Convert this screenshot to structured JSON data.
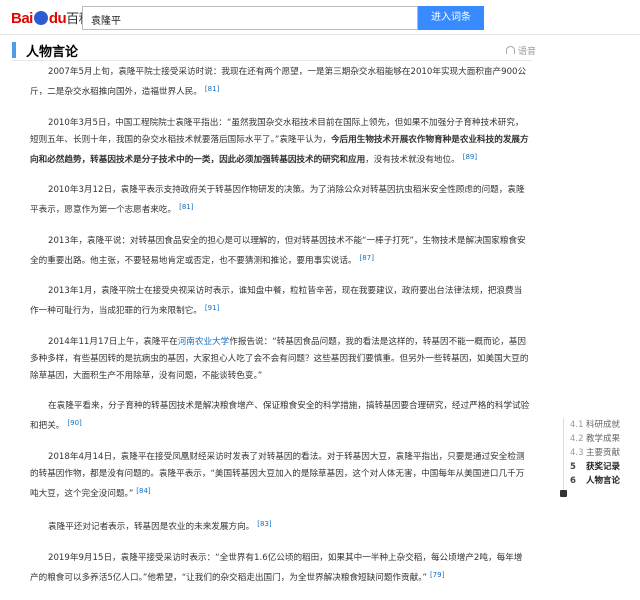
{
  "header": {
    "logo_text": "Bai",
    "logo_text2": "du",
    "logo_cn": "百科",
    "search_value": "袁隆平",
    "enter_button": "进入词条"
  },
  "section": {
    "title": "人物言论",
    "listen_label": "语音"
  },
  "paragraphs": [
    {
      "text": "2007年5月上旬，袁隆平院士接受采访时说：我现在还有两个愿望，一是第三期杂交水稻能够在2010年实现大面积亩产900公斤，二是杂交水稻推向国外，造福世界人民。",
      "ref": "[81]"
    },
    {
      "text_before": "2010年3月5日，中国工程院院士袁隆平指出：“虽然我国杂交水稻技术目前在国际上领先，但如果不加强分子育种技术研究，短则五年、长则十年，我国的杂交水稻技术就要落后国际水平了。”袁隆平认为，",
      "text_bold": "今后用生物技术开展农作物育种是农业科技的发展方向和必然趋势，转基因技术是分子技术中的一类，因此必须加强转基因技术的研究和应用",
      "text_after": "，没有技术就没有地位。",
      "ref": "[89]"
    },
    {
      "text": "2010年3月12日，袁隆平表示支持政府关于转基因作物研发的决策。为了消除公众对转基因抗虫稻米安全性顾虑的问题，袁隆平表示，愿意作为第一个志愿者来吃。",
      "ref": "[81]"
    },
    {
      "text": "2013年，袁隆平说：对转基因食品安全的担心是可以理解的，但对转基因技术不能“一棒子打死”，生物技术是解决国家粮食安全的重要出路。他主张，不要轻易地肯定或否定，也不要猜测和推论，要用事实说话。",
      "ref": "[87]"
    },
    {
      "text": "2013年1月，袁隆平院士在接受央视采访时表示，谁知盘中餐，粒粒皆辛苦，现在我要建议，政府要出台法律法规，把浪费当作一种可耻行为，当成犯罪的行为来限制它。",
      "ref": "[91]"
    },
    {
      "text_before": "2014年11月17日上午，袁隆平在",
      "link": "河南农业大学",
      "text_after": "作报告说：“转基因食品问题，我的看法是这样的，转基因不能一概而论，基因多种多样，有些基因转的是抗病虫的基因，大家担心人吃了会不会有问题？这些基因我们要慎重。但另外一些转基因，如美国大豆的除草基因，大面积生产不用除草，没有问题，不能谈转色变。”",
      "ref": ""
    },
    {
      "text": "在袁隆平看来，分子育种的转基因技术是解决粮食增产、保证粮食安全的科学措施，搞转基因要合理研究，经过严格的科学试验和把关。",
      "ref": "[90]"
    },
    {
      "text": "2018年4月14日，袁隆平在接受凤凰财经采访时发表了对转基因的看法。对于转基因大豆，袁隆平指出，只要是通过安全检测的转基因作物，都是没有问题的。袁隆平表示，“美国转基因大豆加入的是除草基因，这个对人体无害，中国每年从美国进口几千万吨大豆，这个完全没问题。”",
      "ref": "[84]"
    },
    {
      "text": "袁隆平还对记者表示，转基因是农业的未来发展方向。",
      "ref": "[83]"
    },
    {
      "text": "2019年9月15日，袁隆平接受采访时表示：“全世界有1.6亿公顷的稻田，如果其中一半种上杂交稻，每公顷增产2吨，每年增产的粮食可以多养活5亿人口。”他希望，“让我们的杂交稻走出国门，为全世界解决粮食短缺问题作贡献。”",
      "ref": "[79]"
    }
  ],
  "toc": [
    {
      "num": "4.1",
      "label": "科研成就"
    },
    {
      "num": "4.2",
      "label": "教学成果"
    },
    {
      "num": "4.3",
      "label": "主要贡献"
    },
    {
      "num": "5",
      "label": "获奖记录"
    },
    {
      "num": "6",
      "label": "人物言论"
    }
  ]
}
